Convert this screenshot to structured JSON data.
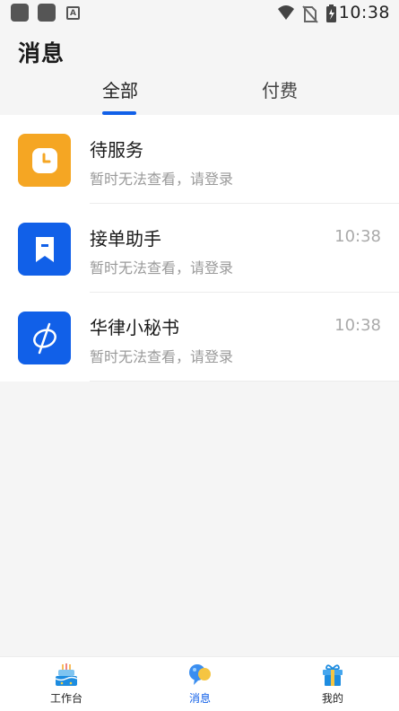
{
  "status_bar": {
    "time": "10:38",
    "left_icons": [
      "app-icon",
      "app-icon",
      "a-icon"
    ],
    "right_icons": [
      "wifi-icon",
      "no-sim-icon",
      "battery-charging-icon"
    ]
  },
  "header": {
    "title": "消息",
    "tabs": [
      {
        "label": "全部",
        "active": true
      },
      {
        "label": "付费",
        "active": false
      }
    ]
  },
  "messages": [
    {
      "title": "待服务",
      "subtitle": "暂时无法查看，请登录",
      "time": "",
      "icon": "clock-icon",
      "color": "#f5a623"
    },
    {
      "title": "接单助手",
      "subtitle": "暂时无法查看，请登录",
      "time": "10:38",
      "icon": "bookmark-icon",
      "color": "#1160e8"
    },
    {
      "title": "华律小秘书",
      "subtitle": "暂时无法查看，请登录",
      "time": "10:38",
      "icon": "huaelv-logo-icon",
      "color": "#1160e8"
    }
  ],
  "bottom_nav": [
    {
      "label": "工作台",
      "icon": "workbench-cake-icon",
      "active": false
    },
    {
      "label": "消息",
      "icon": "message-bubble-icon",
      "active": true
    },
    {
      "label": "我的",
      "icon": "gift-icon",
      "active": false
    }
  ],
  "colors": {
    "accent": "#1160e8",
    "orange": "#f5a623",
    "background": "#f5f5f5"
  }
}
